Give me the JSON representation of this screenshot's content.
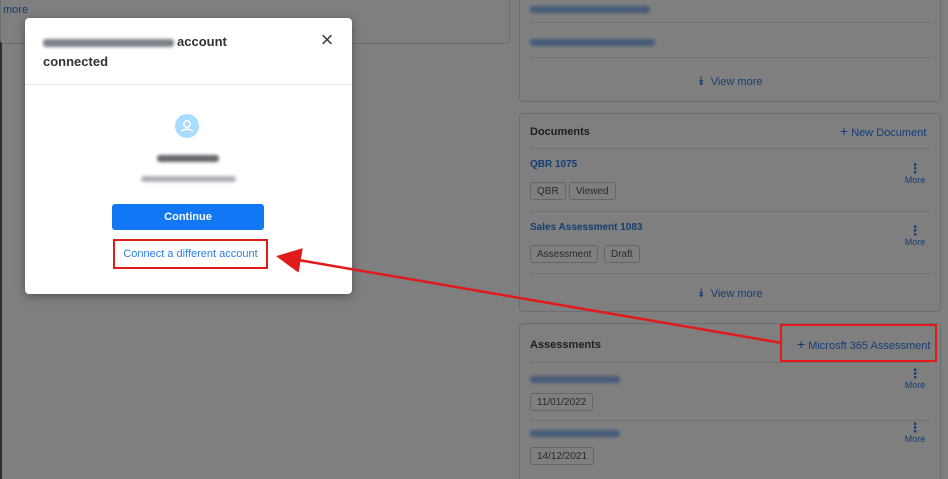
{
  "left": {
    "more_link": "more"
  },
  "bundles": {
    "view_more": "View more"
  },
  "documents": {
    "title": "Documents",
    "new_label": "New Document",
    "items": [
      {
        "name": "QBR 1075",
        "tags": [
          "QBR",
          "Viewed"
        ],
        "more": "More"
      },
      {
        "name": "Sales Assessment 1083",
        "tags": [
          "Assessment",
          "Draft"
        ],
        "more": "More"
      }
    ],
    "view_more": "View more"
  },
  "assessments": {
    "title": "Assessments",
    "new_label": "Microsft 365 Assessment",
    "items": [
      {
        "date": "11/01/2022",
        "more": "More"
      },
      {
        "date": "14/12/2021",
        "more": "More"
      }
    ]
  },
  "modal": {
    "title_suffix": "account",
    "title_line2": "connected",
    "close_glyph": "×",
    "continue_label": "Continue",
    "connect_other_label": "Connect a different account"
  },
  "colors": {
    "accent": "#1277f5",
    "link": "#2b7de9",
    "highlight": "#e11b1b",
    "avatar": "#a9dcff"
  }
}
